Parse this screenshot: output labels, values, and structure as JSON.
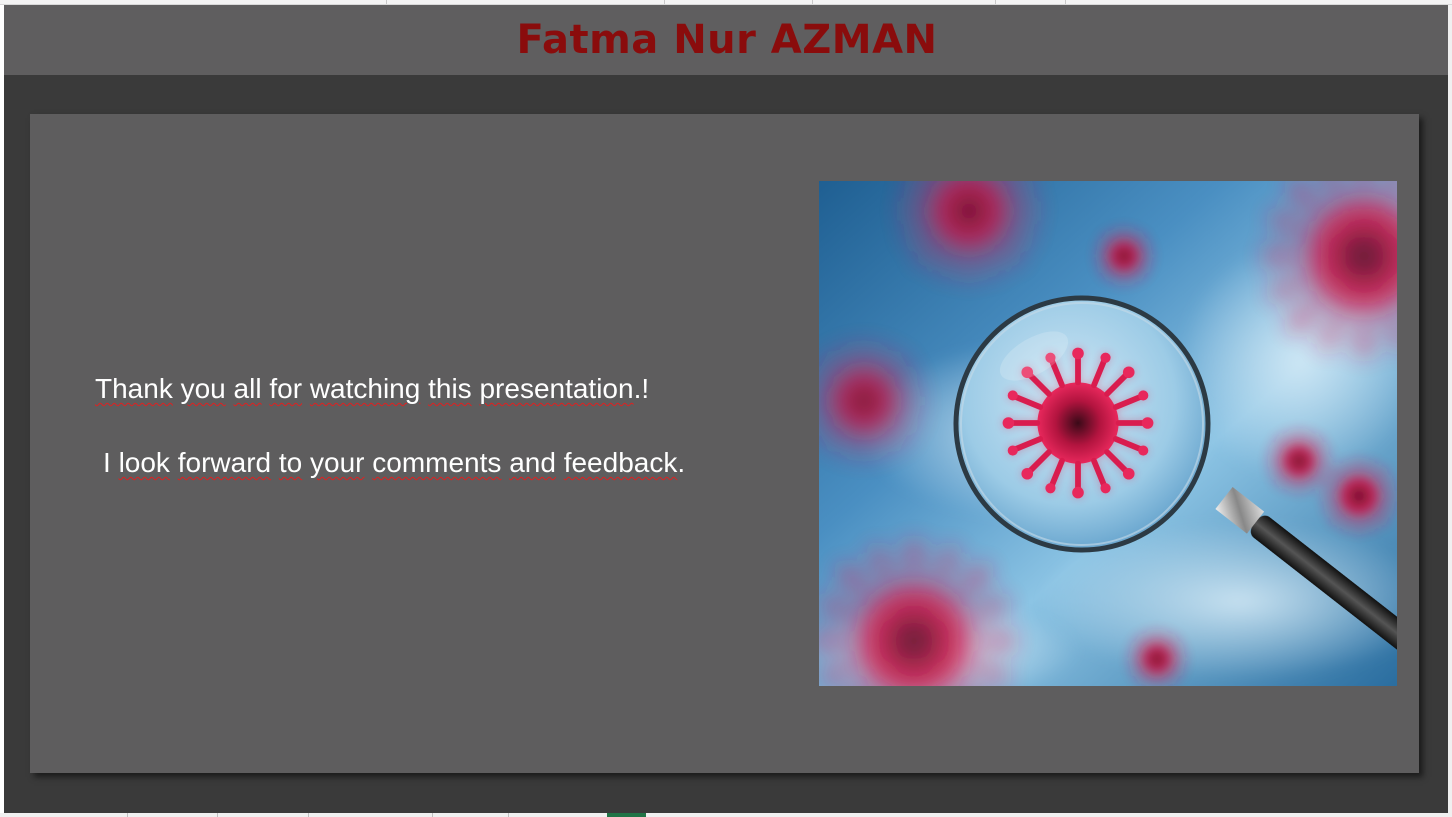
{
  "header": {
    "title": "Fatma Nur AZMAN",
    "title_color": "#8a0c0c"
  },
  "slide": {
    "line1_words": [
      "Thank",
      "you",
      "all",
      "for",
      "watching",
      "this",
      "presentation",
      ".!"
    ],
    "line2_words": [
      "I",
      "look",
      "forward",
      "to",
      "your",
      "comments",
      "and",
      "feedback",
      "."
    ],
    "text_color": "#ffffff",
    "background": "#5e5d5e"
  },
  "image": {
    "icon": "virus-magnifier-photo",
    "accent_virus": "#d91c4e",
    "accent_sky": "#3a7fb5"
  },
  "colors": {
    "workspace": "#3a3a3a",
    "title_band": "#5f5e5f",
    "active_sheet_tab": "#217346"
  }
}
